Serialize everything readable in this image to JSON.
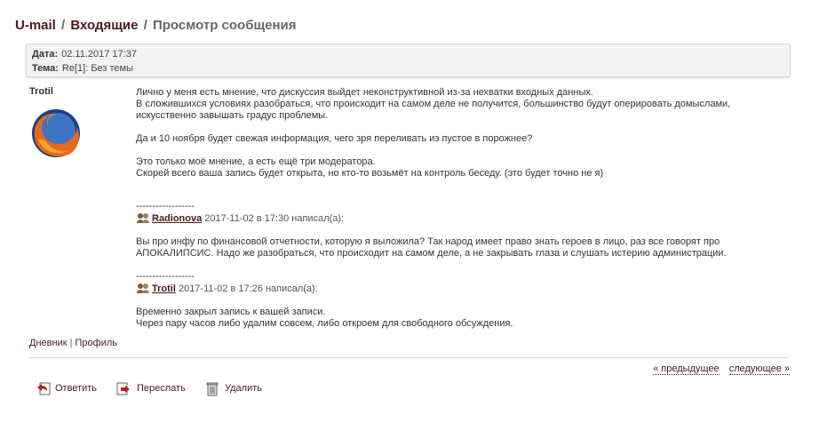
{
  "header": {
    "crumb1": "U-mail",
    "crumb2": "Входящие",
    "current": "Просмотр сообщения",
    "sep": "/"
  },
  "meta": {
    "date_label": "Дата:",
    "date_value": "02.11.2017 17:37",
    "subject_label": "Тема:",
    "subject_value": "Re[1]: Без темы"
  },
  "author": {
    "name": "Trotil",
    "avatar_icon": "firefox-logo"
  },
  "body": {
    "lines1": [
      "Лично у меня есть мнение, что дискуссия выйдет неконструктивной из-за нехватки входных данных.",
      "В сложившихся условиях разобраться, что происходит на самом деле не получится, большинство будут оперировать домыслами,",
      "искусственно завышать градус проблемы."
    ],
    "line2": "Да и 10 ноября будет свежая информация, чего зря переливать из пустое в порожнее?",
    "lines3": [
      "Это только моё мнение, а есть ещё три модератора.",
      "Скорей всего ваша запись будет открыта, но кто-то возьмёт на контроль беседу. (это будет точно не я)"
    ]
  },
  "quotes": [
    {
      "divider": "------------------",
      "user": "Radionova",
      "when": "2017-11-02 в 17:30 написал(а):",
      "lines": [
        "Вы про инфу по финансовой отчетности, которую я выложила? Так народ имеет право знать героев в лицо, раз все говорят про",
        "АПОКАЛИПСИС. Надо же разобраться, что происходит на самом деле, а не закрывать глаза и слушать истерию администрации."
      ]
    },
    {
      "divider": "------------------",
      "user": "Trotil",
      "when": "2017-11-02 в 17:26 написал(а):",
      "lines": [
        "Временно закрыл запись к вашей записи.",
        "Через пару часов либо удалим совсем, либо откроем для свободного обсуждения."
      ]
    }
  ],
  "footer_links": {
    "diary": "Дневник",
    "sep": "|",
    "profile": "Профиль"
  },
  "nav": {
    "prev": "« предыдущее",
    "next": "следующее »"
  },
  "actions": {
    "reply": "Ответить",
    "forward": "Переслать",
    "delete": "Удалить"
  },
  "colors": {
    "link": "#4a1a1a",
    "meta_bg": "#f2f2f2"
  }
}
